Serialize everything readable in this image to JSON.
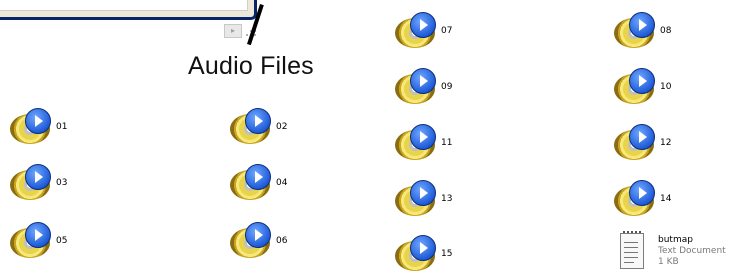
{
  "callout": {
    "label": "Audio Files"
  },
  "files": [
    {
      "name": "01",
      "icon": "audio-cd-icon"
    },
    {
      "name": "02",
      "icon": "audio-cd-icon"
    },
    {
      "name": "03",
      "icon": "audio-cd-icon"
    },
    {
      "name": "04",
      "icon": "audio-cd-icon"
    },
    {
      "name": "05",
      "icon": "audio-cd-icon"
    },
    {
      "name": "06",
      "icon": "audio-cd-icon"
    },
    {
      "name": "07",
      "icon": "audio-cd-icon"
    },
    {
      "name": "08",
      "icon": "audio-cd-icon"
    },
    {
      "name": "09",
      "icon": "audio-cd-icon"
    },
    {
      "name": "10",
      "icon": "audio-cd-icon"
    },
    {
      "name": "11",
      "icon": "audio-cd-icon"
    },
    {
      "name": "12",
      "icon": "audio-cd-icon"
    },
    {
      "name": "13",
      "icon": "audio-cd-icon"
    },
    {
      "name": "14",
      "icon": "audio-cd-icon"
    },
    {
      "name": "15",
      "icon": "audio-cd-icon"
    }
  ],
  "document": {
    "name": "butmap",
    "type": "Text Document",
    "size": "1 KB",
    "icon": "text-document-icon"
  }
}
